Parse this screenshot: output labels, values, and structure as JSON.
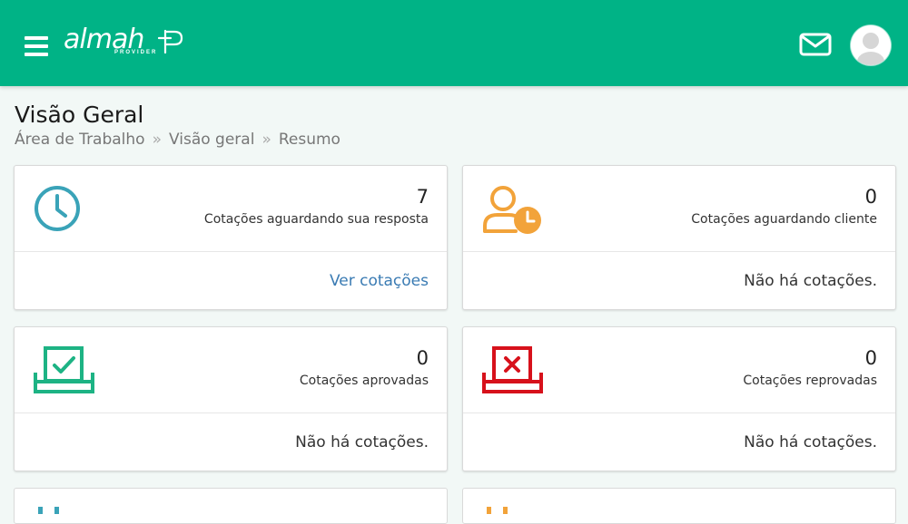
{
  "header": {
    "logo_text": "almah",
    "logo_subtext": "PROVIDER",
    "menu_icon": "hamburger-icon",
    "mail_icon": "envelope-icon",
    "avatar_icon": "user-avatar-icon",
    "brand_color": "#00b386"
  },
  "page": {
    "title": "Visão Geral",
    "breadcrumb": [
      "Área de Trabalho",
      "Visão geral",
      "Resumo"
    ]
  },
  "cards": [
    {
      "icon": "clock-icon",
      "icon_color": "#3aa3b8",
      "count": "7",
      "description": "Cotações aguardando sua resposta",
      "footer": "Ver cotações"
    },
    {
      "icon": "user-clock-icon",
      "icon_color": "#f2a33a",
      "count": "0",
      "description": "Cotações aguardando cliente",
      "footer": "Não há cotações."
    },
    {
      "icon": "approved-tray-icon",
      "icon_color": "#1db384",
      "count": "0",
      "description": "Cotações aprovadas",
      "footer": "Não há cotações."
    },
    {
      "icon": "rejected-tray-icon",
      "icon_color": "#d7111b",
      "count": "0",
      "description": "Cotações reprovadas",
      "footer": "Não há cotações."
    }
  ]
}
